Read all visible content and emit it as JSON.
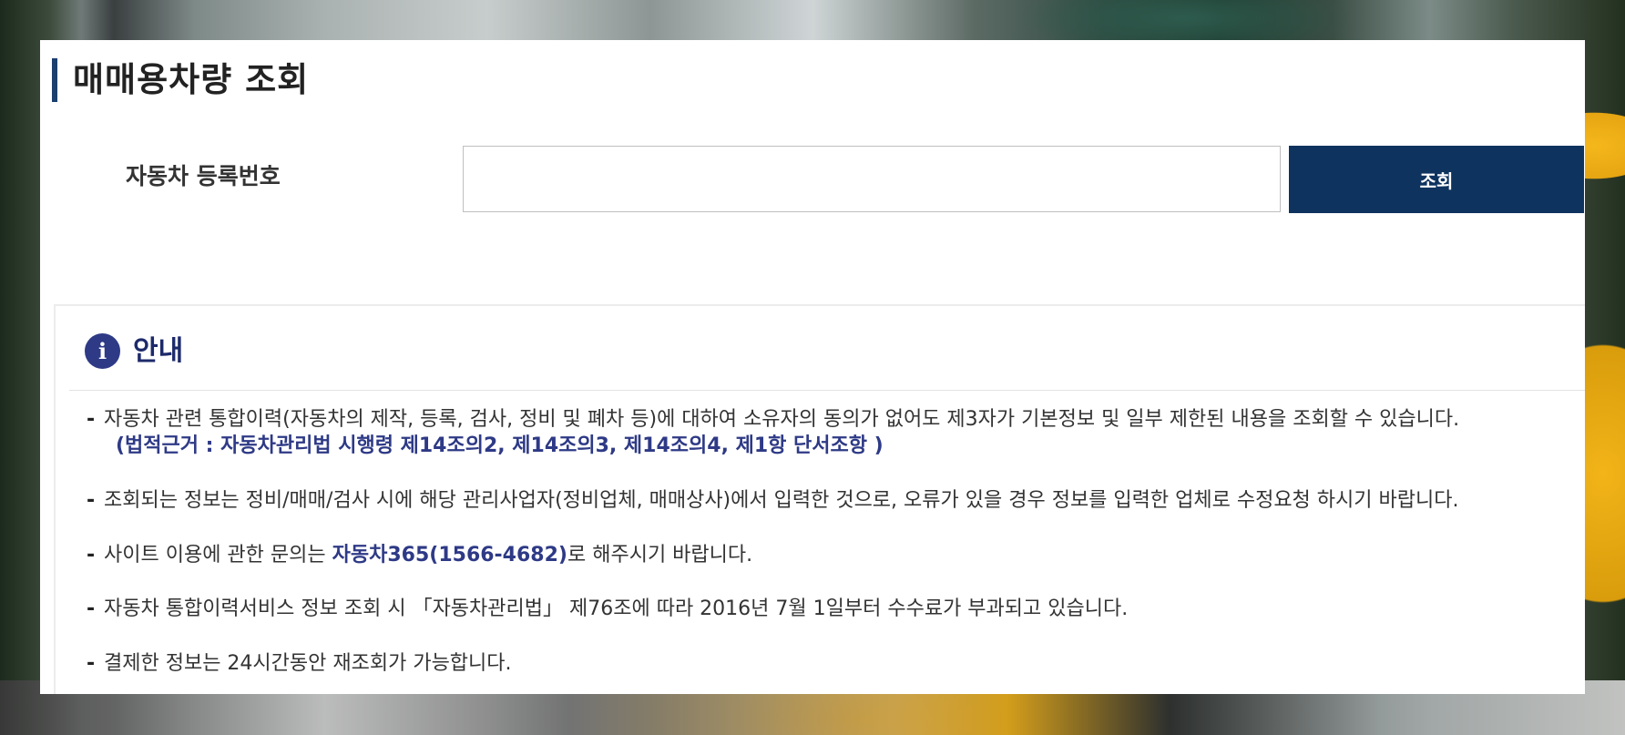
{
  "page": {
    "title": "매매용차량 조회"
  },
  "search": {
    "label": "자동차 등록번호",
    "input_value": "",
    "button_label": "조회"
  },
  "notice": {
    "title": "안내",
    "icon": "info-icon",
    "items": [
      {
        "dash": "-",
        "text": "자동차 관련 통합이력(자동차의 제작, 등록, 검사, 정비 및 폐차 등)에 대하여 소유자의 동의가 없어도 제3자가 기본정보 및 일부 제한된 내용을 조회할 수 있습니다.",
        "legal_basis": "(법적근거 : 자동차관리법 시행령 제14조의2, 제14조의3, 제14조의4, 제1항 단서조항 )"
      },
      {
        "dash": "-",
        "text": "조회되는 정보는 정비/매매/검사 시에 해당 관리사업자(정비업체, 매매상사)에서 입력한 것으로, 오류가 있을 경우 정보를 입력한 업체로 수정요청 하시기 바랍니다."
      },
      {
        "dash": "-",
        "prefix": "사이트 이용에 관한 문의는 ",
        "highlight": "자동차365(1566-4682)",
        "suffix": "로 해주시기 바랍니다."
      },
      {
        "dash": "-",
        "text": "자동차 통합이력서비스 정보 조회 시 「자동차관리법」 제76조에 따라 2016년 7월 1일부터 수수료가 부과되고 있습니다."
      },
      {
        "dash": "-",
        "text": "결제한 정보는 24시간동안 재조회가 가능합니다."
      }
    ]
  },
  "colors": {
    "primary_button": "#0f335f",
    "accent_navy": "#2e3a86",
    "title_bar": "#1b3f6e"
  }
}
